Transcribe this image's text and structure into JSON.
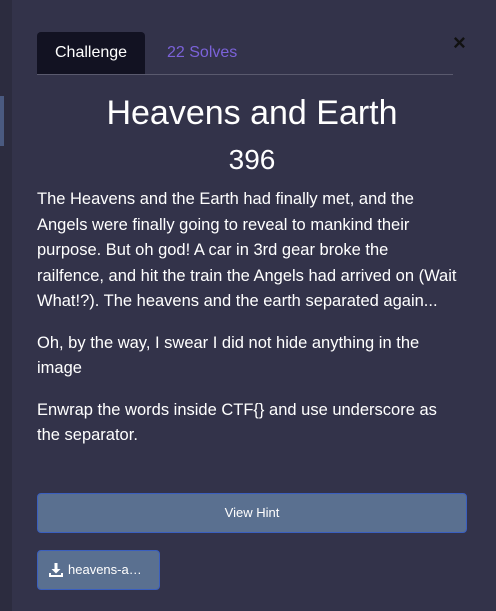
{
  "modal": {
    "close_label": "×",
    "tabs": [
      {
        "label": "Challenge",
        "active": true
      },
      {
        "label": "22 Solves",
        "active": false
      }
    ],
    "challenge": {
      "title": "Heavens and Earth",
      "points": "396",
      "description": [
        "The Heavens and the Earth had finally met, and the Angels were finally going to reveal to mankind their purpose. But oh god! A car in 3rd gear broke the railfence, and hit the train the Angels had arrived on (Wait What!?). The heavens and the earth separated again...",
        "Oh, by the way, I swear I did not hide anything in the image",
        "Enwrap the words inside CTF{} and use underscore as the separator."
      ]
    },
    "hint_button_label": "View Hint",
    "file_button": {
      "label": "heavens-a…",
      "icon": "download-icon"
    }
  },
  "colors": {
    "background": "#33334a",
    "active_tab": "#121222",
    "inactive_tab_text": "#7b62d9",
    "button_fill": "#5a7090",
    "button_border": "#3a5fbf"
  }
}
